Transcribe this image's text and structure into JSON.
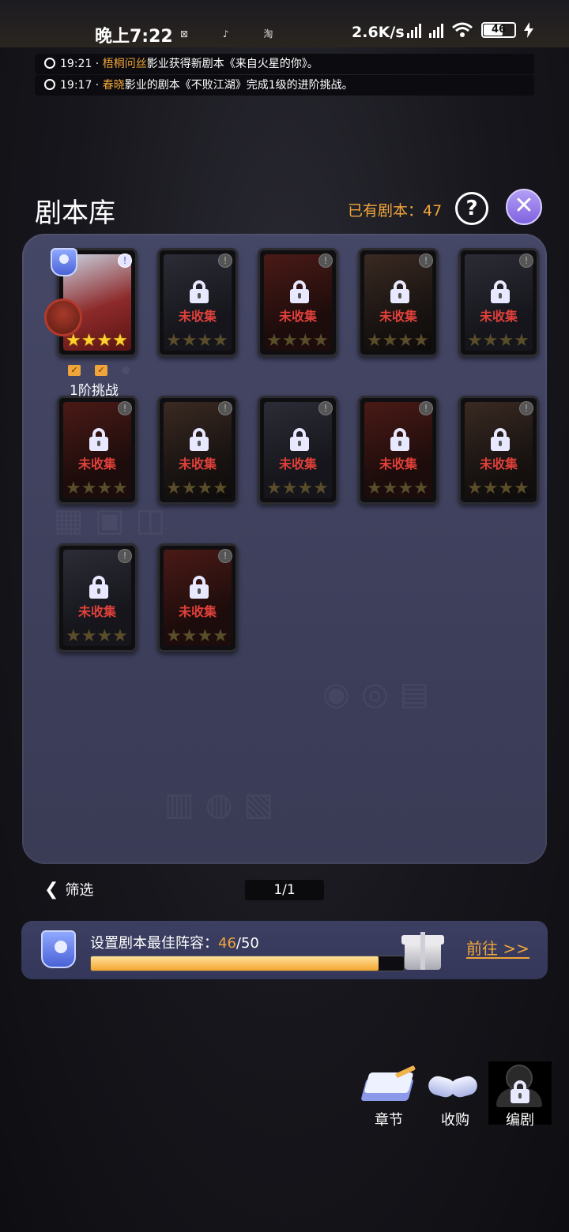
{
  "status_bar": {
    "time": "晚上7:22",
    "app_icons": [
      "bilibili-icon",
      "tiktok-icon",
      "taobao-icon"
    ],
    "app_glyphs": "⊠ ♪ 淘",
    "net_speed": "2.6K/s",
    "battery": "46"
  },
  "news": [
    {
      "time": "19:21 ·",
      "highlight": "梧桐问丝",
      "text": "影业获得新剧本《来自火星的你》。"
    },
    {
      "time": "19:17 ·",
      "highlight": "春晓",
      "text": "影业的剧本《不败江湖》完成1级的进阶挑战。"
    }
  ],
  "header": {
    "title": "剧本库",
    "owned_label": "已有剧本：",
    "owned_count": "47",
    "help_glyph": "?",
    "close_glyph": "✕"
  },
  "cards": {
    "locked_label": "未收集",
    "info_glyph": "!",
    "star_glyph": "★★★★",
    "first_card": {
      "stars": 4,
      "challenge_progress": [
        true,
        true,
        false
      ],
      "challenge_label": "1阶挑战"
    },
    "locked_count": 11
  },
  "footer": {
    "filter_arrow": "❮",
    "filter_label": "筛选",
    "page_indicator": "1/1"
  },
  "best_lineup": {
    "label": "设置剧本最佳阵容：",
    "current": "46",
    "total": "/50",
    "progress": 0.92,
    "goto_label": "前往 >>"
  },
  "bottom_nav": {
    "chapters_label": "章节",
    "acquire_label": "收购",
    "screenwriter_label": "编剧"
  },
  "colors": {
    "accent_orange": "#f0a53a",
    "locked_red": "#e0403a",
    "panel": "#43456a",
    "close_purple": "#9c84ec"
  }
}
